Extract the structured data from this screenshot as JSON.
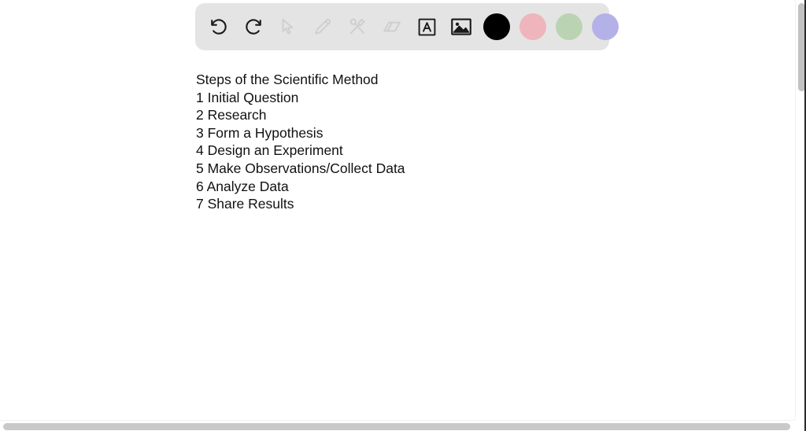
{
  "app": {
    "canvas_background": "#ffffff"
  },
  "toolbar": {
    "background": "#e4e4e4",
    "tools": [
      {
        "name": "undo-icon",
        "label": "Undo",
        "state": "enabled",
        "color": "#1a1a1a"
      },
      {
        "name": "redo-icon",
        "label": "Redo",
        "state": "enabled",
        "color": "#1a1a1a"
      },
      {
        "name": "select-icon",
        "label": "Select",
        "state": "disabled",
        "color": "#cfcfcf"
      },
      {
        "name": "pencil-icon",
        "label": "Draw",
        "state": "disabled",
        "color": "#cfcfcf"
      },
      {
        "name": "shapes-icon",
        "label": "Shapes",
        "state": "disabled",
        "color": "#cfcfcf"
      },
      {
        "name": "eraser-icon",
        "label": "Eraser",
        "state": "disabled",
        "color": "#cfcfcf"
      },
      {
        "name": "text-icon",
        "label": "Text",
        "state": "enabled",
        "color": "#1a1a1a"
      },
      {
        "name": "image-icon",
        "label": "Insert image",
        "state": "enabled",
        "color": "#1a1a1a"
      }
    ],
    "swatches": [
      {
        "name": "color-swatch-black",
        "label": "Black",
        "color": "#000000",
        "selected": true
      },
      {
        "name": "color-swatch-pink",
        "label": "Pink",
        "color": "#efb5bc",
        "selected": false
      },
      {
        "name": "color-swatch-green",
        "label": "Green",
        "color": "#bad4b3",
        "selected": false
      },
      {
        "name": "color-swatch-purple",
        "label": "Purple",
        "color": "#b4b1e8",
        "selected": false
      }
    ]
  },
  "content": {
    "title": "Steps of the Scientific Method",
    "steps": [
      "1 Initial Question",
      "2 Research",
      "3 Form a Hypothesis",
      "4 Design an Experiment",
      "5 Make Observations/Collect Data",
      "6 Analyze Data",
      "7 Share Results"
    ]
  },
  "scrollbars": {
    "vertical": {
      "name": "vertical-scrollbar",
      "thumb_color": "#c2c2c2"
    },
    "horizontal": {
      "name": "horizontal-scrollbar",
      "thumb_color": "#c9c9c9"
    }
  }
}
